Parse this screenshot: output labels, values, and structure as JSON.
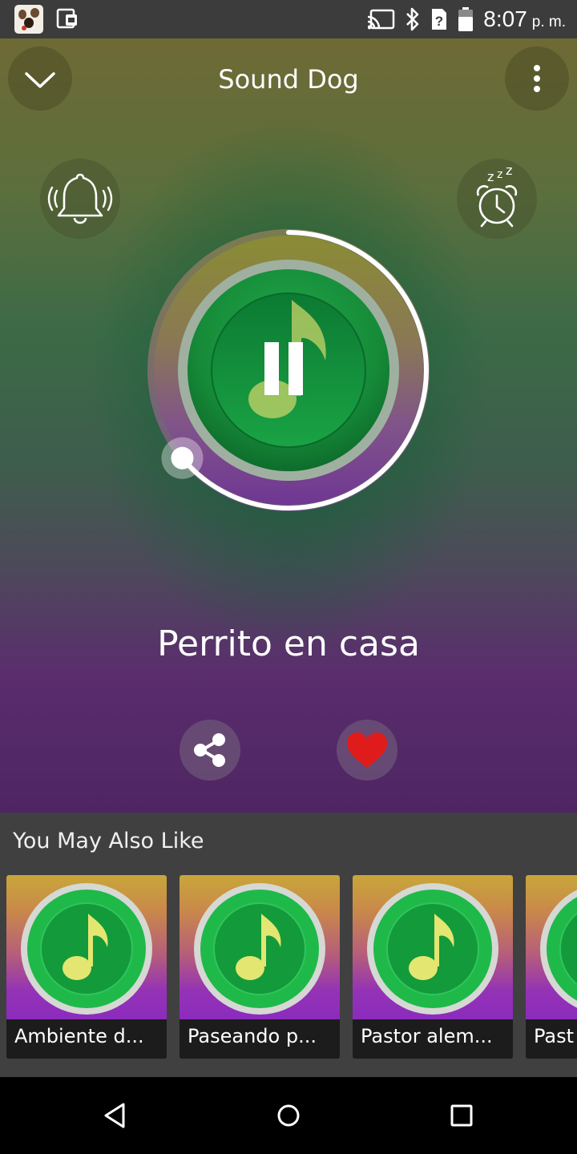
{
  "status_bar": {
    "time": "8:07",
    "ampm": "p. m."
  },
  "header": {
    "title": "Sound Dog"
  },
  "player": {
    "song_title": "Perrito en casa",
    "progress": 0.64,
    "state": "playing"
  },
  "recommendations": {
    "title": "You May Also Like",
    "items": [
      {
        "label": "Ambiente d..."
      },
      {
        "label": "Paseando p..."
      },
      {
        "label": "Pastor alem..."
      },
      {
        "label": "Past"
      }
    ]
  },
  "icons": {
    "collapse": "chevron-down-icon",
    "menu": "more-vert-icon",
    "alarm": "ringing-bell-icon",
    "sleep_timer": "sleep-alarm-clock-icon",
    "play_pause": "pause-icon",
    "share": "share-icon",
    "favorite": "heart-icon"
  },
  "colors": {
    "accent_green": "#1e9e3e",
    "heart": "#e01b1b",
    "card_gradient_top": "#c9a63a",
    "card_gradient_bottom": "#8b2bbd"
  }
}
